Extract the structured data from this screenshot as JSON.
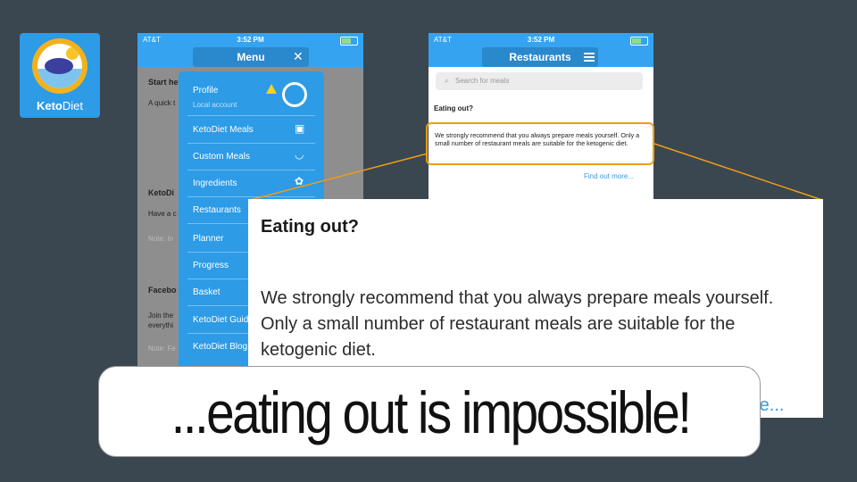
{
  "app": {
    "name_bold": "Keto",
    "name_light": "Diet"
  },
  "phone1": {
    "carrier": "AT&T",
    "time": "3:52 PM",
    "nav_title": "Menu",
    "close_glyph": "✕",
    "background_texts": [
      "Start he",
      "A quick t",
      "KetoDi",
      "Have a c",
      "Note: In",
      "Facebo",
      "Join the",
      "everythi",
      "Note: Fe"
    ],
    "menu": {
      "profile": "Profile",
      "profile_sub": "Local account",
      "items": [
        "KetoDiet Meals",
        "Custom Meals",
        "Ingredients",
        "Restaurants",
        "Planner",
        "Progress",
        "Basket",
        "KetoDiet Guid",
        "KetoDiet Blog"
      ]
    }
  },
  "phone2": {
    "carrier": "AT&T",
    "time": "3:52 PM",
    "nav_title": "Restaurants",
    "search_placeholder": "Search for meals",
    "heading": "Eating out?",
    "body": "We strongly recommend that you always prepare meals yourself. Only a small number of restaurant meals are suitable for the ketogenic diet.",
    "link": "Find out more..."
  },
  "zoom": {
    "heading": "Eating out?",
    "body": "We strongly recommend that you always prepare meals yourself. Only a small number of restaurant meals are suitable for the ketogenic diet.",
    "link_fragment": "re..."
  },
  "caption": "...eating out is impossible!",
  "colors": {
    "background": "#3a4750",
    "brand_blue": "#35a3f0",
    "highlight": "#f29c13",
    "link": "#3b98e0"
  }
}
